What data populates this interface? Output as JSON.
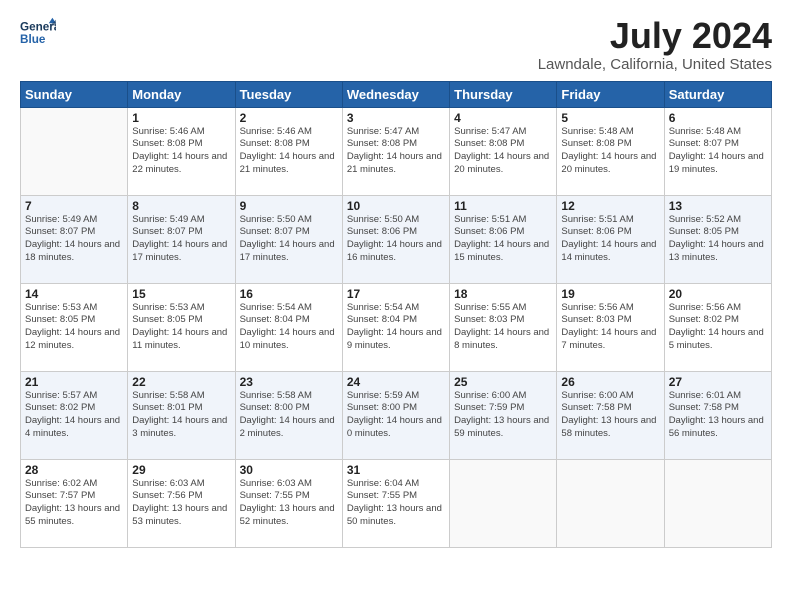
{
  "logo": {
    "line1": "General",
    "line2": "Blue"
  },
  "title": "July 2024",
  "subtitle": "Lawndale, California, United States",
  "days_header": [
    "Sunday",
    "Monday",
    "Tuesday",
    "Wednesday",
    "Thursday",
    "Friday",
    "Saturday"
  ],
  "weeks": [
    [
      {
        "num": "",
        "sunrise": "",
        "sunset": "",
        "daylight": ""
      },
      {
        "num": "1",
        "sunrise": "Sunrise: 5:46 AM",
        "sunset": "Sunset: 8:08 PM",
        "daylight": "Daylight: 14 hours and 22 minutes."
      },
      {
        "num": "2",
        "sunrise": "Sunrise: 5:46 AM",
        "sunset": "Sunset: 8:08 PM",
        "daylight": "Daylight: 14 hours and 21 minutes."
      },
      {
        "num": "3",
        "sunrise": "Sunrise: 5:47 AM",
        "sunset": "Sunset: 8:08 PM",
        "daylight": "Daylight: 14 hours and 21 minutes."
      },
      {
        "num": "4",
        "sunrise": "Sunrise: 5:47 AM",
        "sunset": "Sunset: 8:08 PM",
        "daylight": "Daylight: 14 hours and 20 minutes."
      },
      {
        "num": "5",
        "sunrise": "Sunrise: 5:48 AM",
        "sunset": "Sunset: 8:08 PM",
        "daylight": "Daylight: 14 hours and 20 minutes."
      },
      {
        "num": "6",
        "sunrise": "Sunrise: 5:48 AM",
        "sunset": "Sunset: 8:07 PM",
        "daylight": "Daylight: 14 hours and 19 minutes."
      }
    ],
    [
      {
        "num": "7",
        "sunrise": "Sunrise: 5:49 AM",
        "sunset": "Sunset: 8:07 PM",
        "daylight": "Daylight: 14 hours and 18 minutes."
      },
      {
        "num": "8",
        "sunrise": "Sunrise: 5:49 AM",
        "sunset": "Sunset: 8:07 PM",
        "daylight": "Daylight: 14 hours and 17 minutes."
      },
      {
        "num": "9",
        "sunrise": "Sunrise: 5:50 AM",
        "sunset": "Sunset: 8:07 PM",
        "daylight": "Daylight: 14 hours and 17 minutes."
      },
      {
        "num": "10",
        "sunrise": "Sunrise: 5:50 AM",
        "sunset": "Sunset: 8:06 PM",
        "daylight": "Daylight: 14 hours and 16 minutes."
      },
      {
        "num": "11",
        "sunrise": "Sunrise: 5:51 AM",
        "sunset": "Sunset: 8:06 PM",
        "daylight": "Daylight: 14 hours and 15 minutes."
      },
      {
        "num": "12",
        "sunrise": "Sunrise: 5:51 AM",
        "sunset": "Sunset: 8:06 PM",
        "daylight": "Daylight: 14 hours and 14 minutes."
      },
      {
        "num": "13",
        "sunrise": "Sunrise: 5:52 AM",
        "sunset": "Sunset: 8:05 PM",
        "daylight": "Daylight: 14 hours and 13 minutes."
      }
    ],
    [
      {
        "num": "14",
        "sunrise": "Sunrise: 5:53 AM",
        "sunset": "Sunset: 8:05 PM",
        "daylight": "Daylight: 14 hours and 12 minutes."
      },
      {
        "num": "15",
        "sunrise": "Sunrise: 5:53 AM",
        "sunset": "Sunset: 8:05 PM",
        "daylight": "Daylight: 14 hours and 11 minutes."
      },
      {
        "num": "16",
        "sunrise": "Sunrise: 5:54 AM",
        "sunset": "Sunset: 8:04 PM",
        "daylight": "Daylight: 14 hours and 10 minutes."
      },
      {
        "num": "17",
        "sunrise": "Sunrise: 5:54 AM",
        "sunset": "Sunset: 8:04 PM",
        "daylight": "Daylight: 14 hours and 9 minutes."
      },
      {
        "num": "18",
        "sunrise": "Sunrise: 5:55 AM",
        "sunset": "Sunset: 8:03 PM",
        "daylight": "Daylight: 14 hours and 8 minutes."
      },
      {
        "num": "19",
        "sunrise": "Sunrise: 5:56 AM",
        "sunset": "Sunset: 8:03 PM",
        "daylight": "Daylight: 14 hours and 7 minutes."
      },
      {
        "num": "20",
        "sunrise": "Sunrise: 5:56 AM",
        "sunset": "Sunset: 8:02 PM",
        "daylight": "Daylight: 14 hours and 5 minutes."
      }
    ],
    [
      {
        "num": "21",
        "sunrise": "Sunrise: 5:57 AM",
        "sunset": "Sunset: 8:02 PM",
        "daylight": "Daylight: 14 hours and 4 minutes."
      },
      {
        "num": "22",
        "sunrise": "Sunrise: 5:58 AM",
        "sunset": "Sunset: 8:01 PM",
        "daylight": "Daylight: 14 hours and 3 minutes."
      },
      {
        "num": "23",
        "sunrise": "Sunrise: 5:58 AM",
        "sunset": "Sunset: 8:00 PM",
        "daylight": "Daylight: 14 hours and 2 minutes."
      },
      {
        "num": "24",
        "sunrise": "Sunrise: 5:59 AM",
        "sunset": "Sunset: 8:00 PM",
        "daylight": "Daylight: 14 hours and 0 minutes."
      },
      {
        "num": "25",
        "sunrise": "Sunrise: 6:00 AM",
        "sunset": "Sunset: 7:59 PM",
        "daylight": "Daylight: 13 hours and 59 minutes."
      },
      {
        "num": "26",
        "sunrise": "Sunrise: 6:00 AM",
        "sunset": "Sunset: 7:58 PM",
        "daylight": "Daylight: 13 hours and 58 minutes."
      },
      {
        "num": "27",
        "sunrise": "Sunrise: 6:01 AM",
        "sunset": "Sunset: 7:58 PM",
        "daylight": "Daylight: 13 hours and 56 minutes."
      }
    ],
    [
      {
        "num": "28",
        "sunrise": "Sunrise: 6:02 AM",
        "sunset": "Sunset: 7:57 PM",
        "daylight": "Daylight: 13 hours and 55 minutes."
      },
      {
        "num": "29",
        "sunrise": "Sunrise: 6:03 AM",
        "sunset": "Sunset: 7:56 PM",
        "daylight": "Daylight: 13 hours and 53 minutes."
      },
      {
        "num": "30",
        "sunrise": "Sunrise: 6:03 AM",
        "sunset": "Sunset: 7:55 PM",
        "daylight": "Daylight: 13 hours and 52 minutes."
      },
      {
        "num": "31",
        "sunrise": "Sunrise: 6:04 AM",
        "sunset": "Sunset: 7:55 PM",
        "daylight": "Daylight: 13 hours and 50 minutes."
      },
      {
        "num": "",
        "sunrise": "",
        "sunset": "",
        "daylight": ""
      },
      {
        "num": "",
        "sunrise": "",
        "sunset": "",
        "daylight": ""
      },
      {
        "num": "",
        "sunrise": "",
        "sunset": "",
        "daylight": ""
      }
    ]
  ]
}
